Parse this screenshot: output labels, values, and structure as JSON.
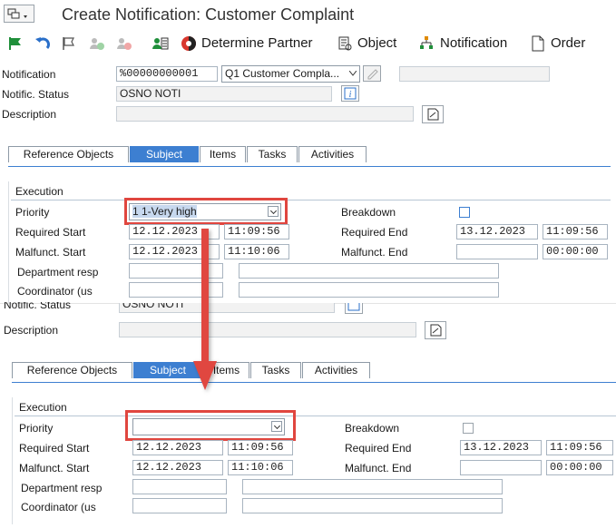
{
  "window": {
    "title": "Create Notification: Customer Complaint"
  },
  "toolbar": {
    "determine_partner": "Determine Partner",
    "object": "Object",
    "notification": "Notification",
    "order": "Order"
  },
  "header": {
    "notification_label": "Notification",
    "notification_value": "%00000000001",
    "notification_type": "Q1 Customer Compla...",
    "status_label": "Notific. Status",
    "status_value": "OSNO NOTI",
    "description_label": "Description"
  },
  "tabs": [
    "Reference Objects",
    "Subject",
    "Items",
    "Tasks",
    "Activities"
  ],
  "execution": {
    "group_title": "Execution",
    "priority_label": "Priority",
    "priority_value_before": "1 1-Very high",
    "priority_value_after": "",
    "breakdown_label": "Breakdown",
    "required_start_label": "Required Start",
    "required_start_date": "12.12.2023",
    "required_start_time": "11:09:56",
    "required_end_label": "Required End",
    "required_end_date": "13.12.2023",
    "required_end_time": "11:09:56",
    "malfunct_start_label": "Malfunct. Start",
    "malfunct_start_date": "12.12.2023",
    "malfunct_start_time": "11:10:06",
    "malfunct_end_label": "Malfunct. End",
    "malfunct_end_time": "00:00:00",
    "department_label": "Department resp",
    "coordinator_label": "Coordinator (us"
  },
  "colors": {
    "accent": "#3d7fd1",
    "highlight": "#e0463f"
  }
}
